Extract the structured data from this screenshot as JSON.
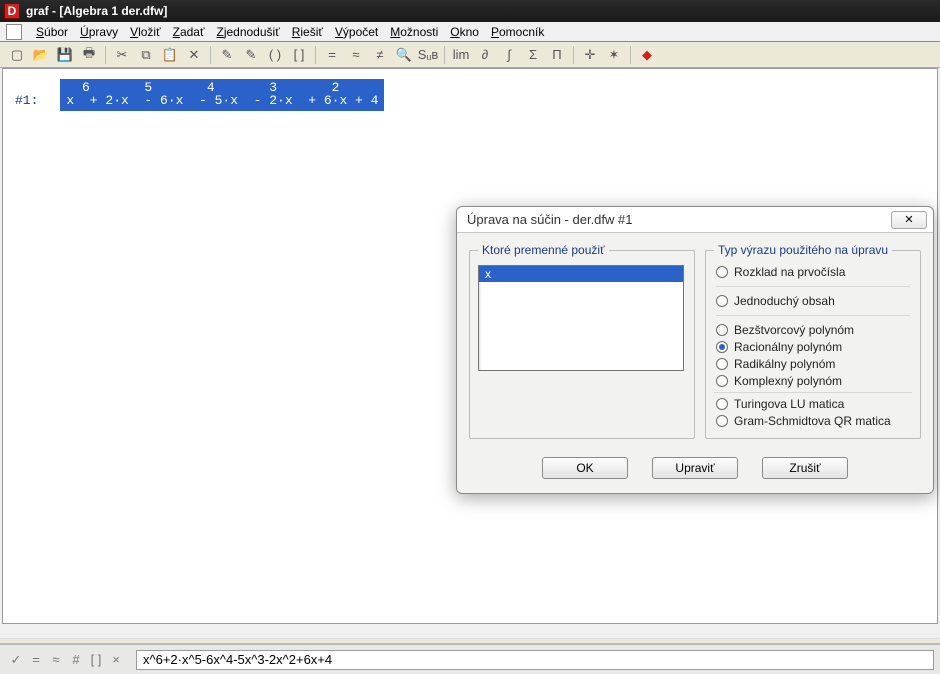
{
  "title": "graf - [Algebra 1  der.dfw]",
  "menu": {
    "items": [
      {
        "ul": "S",
        "rest": "úbor"
      },
      {
        "ul": "Ú",
        "rest": "pravy"
      },
      {
        "ul": "V",
        "rest": "ložiť"
      },
      {
        "ul": "Z",
        "rest": "adať"
      },
      {
        "ul": "Z",
        "rest": "jednodušiť"
      },
      {
        "ul": "R",
        "rest": "iešiť"
      },
      {
        "ul": "V",
        "rest": "ýpočet"
      },
      {
        "ul": "M",
        "rest": "ožnosti"
      },
      {
        "ul": "O",
        "rest": "kno"
      },
      {
        "ul": "P",
        "rest": "omocník"
      }
    ]
  },
  "toolbar": {
    "groups": [
      [
        "new-icon",
        "open-icon",
        "save-icon",
        "print-icon"
      ],
      [
        "cut-icon",
        "copy-icon",
        "paste-icon",
        "delete-icon"
      ],
      [
        "edit-expr-icon",
        "author-icon",
        "paren-icon",
        "bracket-icon"
      ],
      [
        "equals-icon",
        "approx-icon",
        "simplify-icon",
        "zoom-icon",
        "sub-icon"
      ],
      [
        "lim-icon",
        "deriv-icon",
        "integral-icon",
        "sigma-icon",
        "pi-icon"
      ],
      [
        "plot-icon",
        "axes-icon"
      ],
      [
        "help-icon"
      ]
    ],
    "glyphs": {
      "new-icon": "▢",
      "open-icon": "📂",
      "save-icon": "💾",
      "print-icon": "🖶",
      "cut-icon": "✂",
      "copy-icon": "⧉",
      "paste-icon": "📋",
      "delete-icon": "✕",
      "edit-expr-icon": "✎",
      "author-icon": "✎",
      "paren-icon": "( )",
      "bracket-icon": "[ ]",
      "equals-icon": "=",
      "approx-icon": "≈",
      "simplify-icon": "≠",
      "zoom-icon": "🔍",
      "sub-icon": "Sᵤʙ",
      "lim-icon": "lim",
      "deriv-icon": "∂",
      "integral-icon": "∫",
      "sigma-icon": "Σ",
      "pi-icon": "Π",
      "plot-icon": "✛",
      "axes-icon": "✶",
      "help-icon": "◆"
    }
  },
  "expression": {
    "label": "#1:",
    "exponents_line": "  6       5       4       3       2",
    "body_line": "x  + 2·x  - 6·x  - 5·x  - 2·x  + 6·x + 4"
  },
  "dialog": {
    "title": "Úprava na súčin - der.dfw #1",
    "vars_group": "Ktoré premenné použiť",
    "vars": [
      "x"
    ],
    "type_group": "Typ výrazu použitého na úpravu",
    "radios1": [
      {
        "label": "Rozklad na prvočísla",
        "sel": false
      },
      {
        "label": "Jednoduchý obsah",
        "sel": false
      },
      {
        "label": "Bezštvorcový polynóm",
        "sel": false
      },
      {
        "label": "Racionálny polynóm",
        "sel": true
      },
      {
        "label": "Radikálny polynóm",
        "sel": false
      },
      {
        "label": "Komplexný polynóm",
        "sel": false
      }
    ],
    "radios2": [
      {
        "label": "Turingova LU matica",
        "sel": false
      },
      {
        "label": "Gram-Schmidtova QR matica",
        "sel": false
      }
    ],
    "buttons": {
      "ok": "OK",
      "upravit": "Upraviť",
      "zrusit": "Zrušiť"
    }
  },
  "input_line": "x^6+2·x^5-6x^4-5x^3-2x^2+6x+4",
  "bottom_tools": [
    "check-icon",
    "equals-icon",
    "approx-icon",
    "clear-icon",
    "bracket-icon",
    "paren-icon"
  ],
  "bottom_glyphs": {
    "check-icon": "✓",
    "equals-icon": "=",
    "approx-icon": "≈",
    "clear-icon": "#",
    "bracket-icon": "[ ]",
    "paren-icon": "×"
  }
}
